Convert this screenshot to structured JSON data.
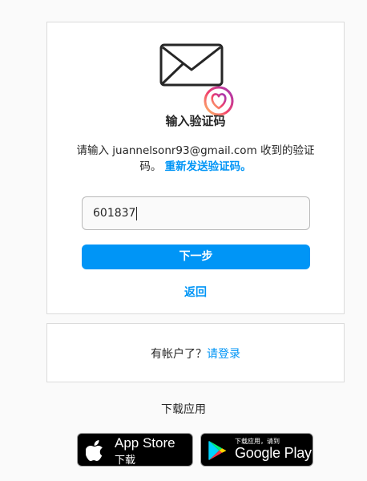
{
  "verify": {
    "icon": "envelope-with-heart-icon",
    "title": "输入验证码",
    "description": "请输入 juannelsonr93@gmail.com 收到的验证码。",
    "resend_label": "重新发送验证码。",
    "code_value": "601837",
    "next_label": "下一步",
    "back_label": "返回"
  },
  "login": {
    "prompt": "有帐户了？",
    "link_label": "请登录"
  },
  "get_app": {
    "label": "下载应用",
    "app_store": {
      "icon": "apple-icon",
      "line1": "App Store",
      "line2": "下载"
    },
    "google_play": {
      "icon": "google-play-icon",
      "line1": "下载应用，请到",
      "line2": "Google Play"
    }
  },
  "colors": {
    "accent": "#0095f6",
    "text": "#262626",
    "border": "#dbdbdb",
    "background": "#fafafa"
  }
}
